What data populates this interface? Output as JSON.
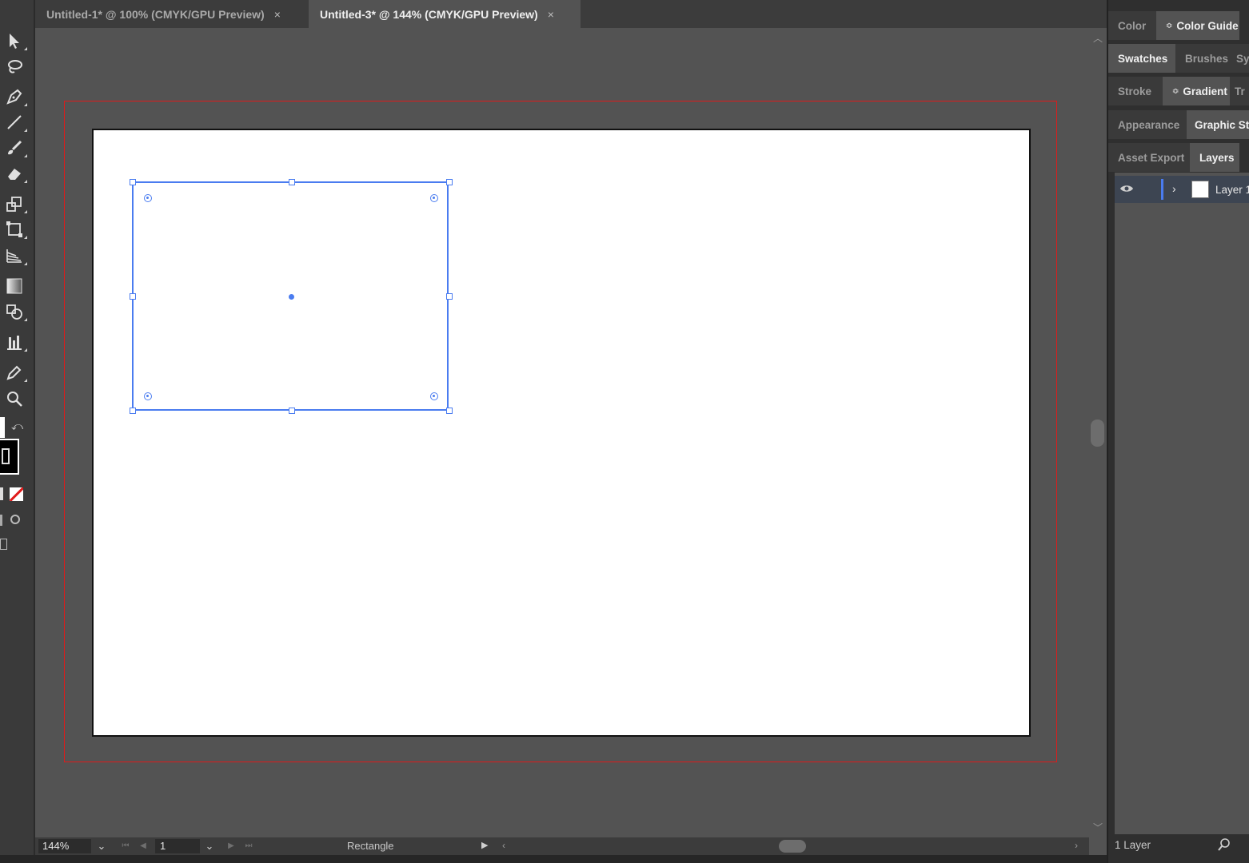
{
  "tabs": [
    {
      "title": "Untitled-1* @ 100% (CMYK/GPU Preview)",
      "active": false,
      "close": "×"
    },
    {
      "title": "Untitled-3* @ 144% (CMYK/GPU Preview)",
      "active": true,
      "close": "×"
    }
  ],
  "toolbar": {
    "tools": [
      "selection-tool",
      "lasso-tool",
      "pen-tool",
      "line-segment-tool",
      "paintbrush-tool",
      "eraser-tool",
      "scale-tool",
      "free-transform-tool",
      "perspective-grid-tool",
      "gradient-tool",
      "shape-builder-tool",
      "column-graph-tool",
      "eyedropper-tool",
      "zoom-tool"
    ]
  },
  "canvas": {
    "selected_object": "rectangle"
  },
  "status": {
    "zoom": "144%",
    "page": "1",
    "current_tool": "Rectangle"
  },
  "right_panel": {
    "rows": [
      {
        "tabs": [
          {
            "label": "Color",
            "active": false,
            "dropdown": false
          },
          {
            "label": "Color Guide",
            "active": true,
            "dropdown": true
          }
        ]
      },
      {
        "tabs": [
          {
            "label": "Swatches",
            "active": true,
            "dropdown": false
          },
          {
            "label": "Brushes",
            "active": false,
            "dropdown": false
          },
          {
            "label": "Sy",
            "active": false,
            "dropdown": false
          }
        ]
      },
      {
        "tabs": [
          {
            "label": "Stroke",
            "active": false,
            "dropdown": false
          },
          {
            "label": "Gradient",
            "active": true,
            "dropdown": true
          },
          {
            "label": "Tr",
            "active": false,
            "dropdown": false
          }
        ]
      },
      {
        "tabs": [
          {
            "label": "Appearance",
            "active": false,
            "dropdown": false
          },
          {
            "label": "Graphic St",
            "active": true,
            "dropdown": false
          }
        ]
      },
      {
        "tabs": [
          {
            "label": "Asset Export",
            "active": false,
            "dropdown": false
          },
          {
            "label": "Layers",
            "active": true,
            "dropdown": false
          }
        ]
      }
    ],
    "layers": [
      {
        "name": "Layer 1",
        "visible": true,
        "color": "#4a7cf0"
      }
    ],
    "footer": {
      "count": "1 Layer"
    }
  },
  "colors": {
    "selection": "#4a7cf0",
    "bleed": "#e01a1a",
    "workspace": "#535353"
  }
}
